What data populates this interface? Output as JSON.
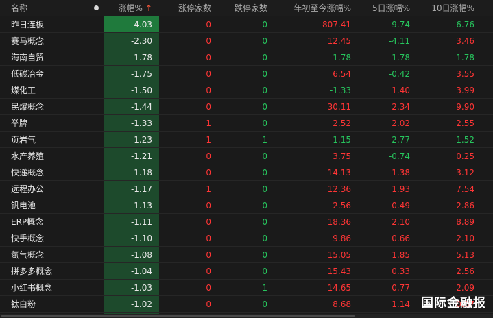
{
  "header": {
    "name": "名称",
    "pct": "涨幅%",
    "sort_icon": "↑",
    "limit_up": "涨停家数",
    "limit_down": "跌停家数",
    "ytd": "年初至今涨幅%",
    "d5": "5日涨幅%",
    "d10": "10日涨幅%"
  },
  "colors": {
    "red": "#ff3535",
    "green": "#27c45d",
    "pct_bg": "#1d4a2c",
    "pct_top": "#1f7a3c"
  },
  "rows": [
    {
      "name": "昨日连板",
      "pct": "-4.03",
      "up": "0",
      "down": "0",
      "ytd": "807.41",
      "d5": "-9.74",
      "d10": "-6.76"
    },
    {
      "name": "赛马概念",
      "pct": "-2.30",
      "up": "0",
      "down": "0",
      "ytd": "12.45",
      "d5": "-4.11",
      "d10": "3.46"
    },
    {
      "name": "海南自贸",
      "pct": "-1.78",
      "up": "0",
      "down": "0",
      "ytd": "-1.78",
      "d5": "-1.78",
      "d10": "-1.78"
    },
    {
      "name": "低碳冶金",
      "pct": "-1.75",
      "up": "0",
      "down": "0",
      "ytd": "6.54",
      "d5": "-0.42",
      "d10": "3.55"
    },
    {
      "name": "煤化工",
      "pct": "-1.50",
      "up": "0",
      "down": "0",
      "ytd": "-1.33",
      "d5": "1.40",
      "d10": "3.99"
    },
    {
      "name": "民爆概念",
      "pct": "-1.44",
      "up": "0",
      "down": "0",
      "ytd": "30.11",
      "d5": "2.34",
      "d10": "9.90"
    },
    {
      "name": "举牌",
      "pct": "-1.33",
      "up": "1",
      "down": "0",
      "ytd": "2.52",
      "d5": "2.02",
      "d10": "2.55"
    },
    {
      "name": "页岩气",
      "pct": "-1.23",
      "up": "1",
      "down": "1",
      "ytd": "-1.15",
      "d5": "-2.77",
      "d10": "-1.52"
    },
    {
      "name": "水产养殖",
      "pct": "-1.21",
      "up": "0",
      "down": "0",
      "ytd": "3.75",
      "d5": "-0.74",
      "d10": "0.25"
    },
    {
      "name": "快递概念",
      "pct": "-1.18",
      "up": "0",
      "down": "0",
      "ytd": "14.13",
      "d5": "1.38",
      "d10": "3.12"
    },
    {
      "name": "远程办公",
      "pct": "-1.17",
      "up": "1",
      "down": "0",
      "ytd": "12.36",
      "d5": "1.93",
      "d10": "7.54"
    },
    {
      "name": "钒电池",
      "pct": "-1.13",
      "up": "0",
      "down": "0",
      "ytd": "2.56",
      "d5": "0.49",
      "d10": "2.86"
    },
    {
      "name": "ERP概念",
      "pct": "-1.11",
      "up": "0",
      "down": "0",
      "ytd": "18.36",
      "d5": "2.10",
      "d10": "8.89"
    },
    {
      "name": "快手概念",
      "pct": "-1.10",
      "up": "0",
      "down": "0",
      "ytd": "9.86",
      "d5": "0.66",
      "d10": "2.10"
    },
    {
      "name": "氮气概念",
      "pct": "-1.08",
      "up": "0",
      "down": "0",
      "ytd": "15.05",
      "d5": "1.85",
      "d10": "5.13"
    },
    {
      "name": "拼多多概念",
      "pct": "-1.04",
      "up": "0",
      "down": "0",
      "ytd": "15.43",
      "d5": "0.33",
      "d10": "2.56"
    },
    {
      "name": "小红书概念",
      "pct": "-1.03",
      "up": "0",
      "down": "1",
      "ytd": "14.65",
      "d5": "0.77",
      "d10": "2.09"
    },
    {
      "name": "钛白粉",
      "pct": "-1.02",
      "up": "0",
      "down": "0",
      "ytd": "8.68",
      "d5": "1.14",
      "d10": "0.87"
    }
  ],
  "watermark": "国际金融报"
}
